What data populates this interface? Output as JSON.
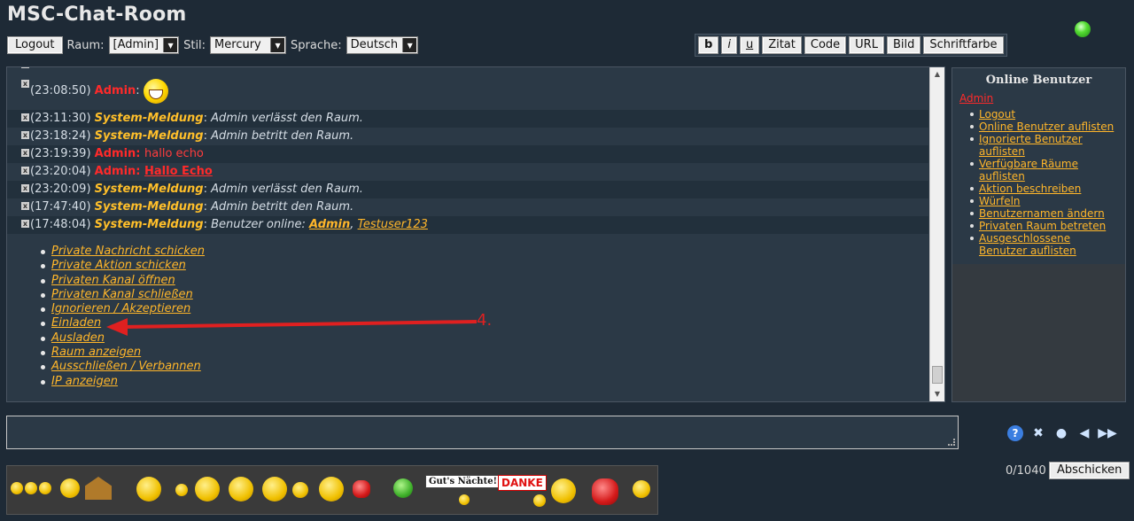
{
  "app": {
    "title": "MSC-Chat-Room"
  },
  "toolbar": {
    "logout_label": "Logout",
    "room_label": "Raum:",
    "room_value": "[Admin]",
    "style_label": "Stil:",
    "style_value": "Mercury",
    "language_label": "Sprache:",
    "language_value": "Deutsch"
  },
  "bbcode": {
    "bold": "b",
    "italic": "i",
    "underline": "u",
    "quote": "Zitat",
    "code": "Code",
    "url": "URL",
    "image": "Bild",
    "fontcolor": "Schriftfarbe"
  },
  "messages": [
    {
      "time": "(23:08:50)",
      "user": "Admin"
    },
    {
      "time": "(23:11:30)",
      "user": "System-Meldung",
      "text": "Admin verlässt den Raum."
    },
    {
      "time": "(23:18:24)",
      "user": "System-Meldung",
      "text": "Admin betritt den Raum."
    },
    {
      "time": "(23:19:39)",
      "user": "Admin",
      "text": "hallo echo"
    },
    {
      "time": "(23:20:04)",
      "user": "Admin",
      "text": "Hallo Echo"
    },
    {
      "time": "(23:20:09)",
      "user": "System-Meldung",
      "text": "Admin verlässt den Raum."
    },
    {
      "time": "(17:47:40)",
      "user": "System-Meldung",
      "text": "Admin betritt den Raum."
    },
    {
      "time": "(17:48:04)",
      "user": "System-Meldung",
      "text": "Benutzer online:",
      "users": [
        "Admin",
        "Testuser123"
      ]
    }
  ],
  "actions": [
    "Private Nachricht schicken",
    "Private Aktion schicken",
    "Privaten Kanal öffnen",
    "Privaten Kanal schließen",
    "Ignorieren / Akzeptieren",
    "Einladen",
    "Ausladen",
    "Raum anzeigen",
    "Ausschließen / Verbannen",
    "IP anzeigen"
  ],
  "annotation": {
    "label": "4.",
    "color": "#e02020"
  },
  "online": {
    "title": "Online Benutzer",
    "user": "Admin",
    "items": [
      "Logout",
      "Online Benutzer auflisten",
      "Ignorierte Benutzer auflisten",
      "Verfügbare Räume auflisten",
      "Aktion beschreiben",
      "Würfeln",
      "Benutzernamen ändern",
      "Privaten Raum betreten",
      "Ausgeschlossene Benutzer auflisten"
    ]
  },
  "input": {
    "counter": "0/1040",
    "send_label": "Abschicken"
  },
  "emoticons": {
    "sign1": "Gut's Nächte!",
    "sign2": "DANKE"
  },
  "colors": {
    "admin": "#ff2a2a",
    "system": "#ffbf2a",
    "link": "#ffb62a",
    "status": "#55dd33"
  }
}
